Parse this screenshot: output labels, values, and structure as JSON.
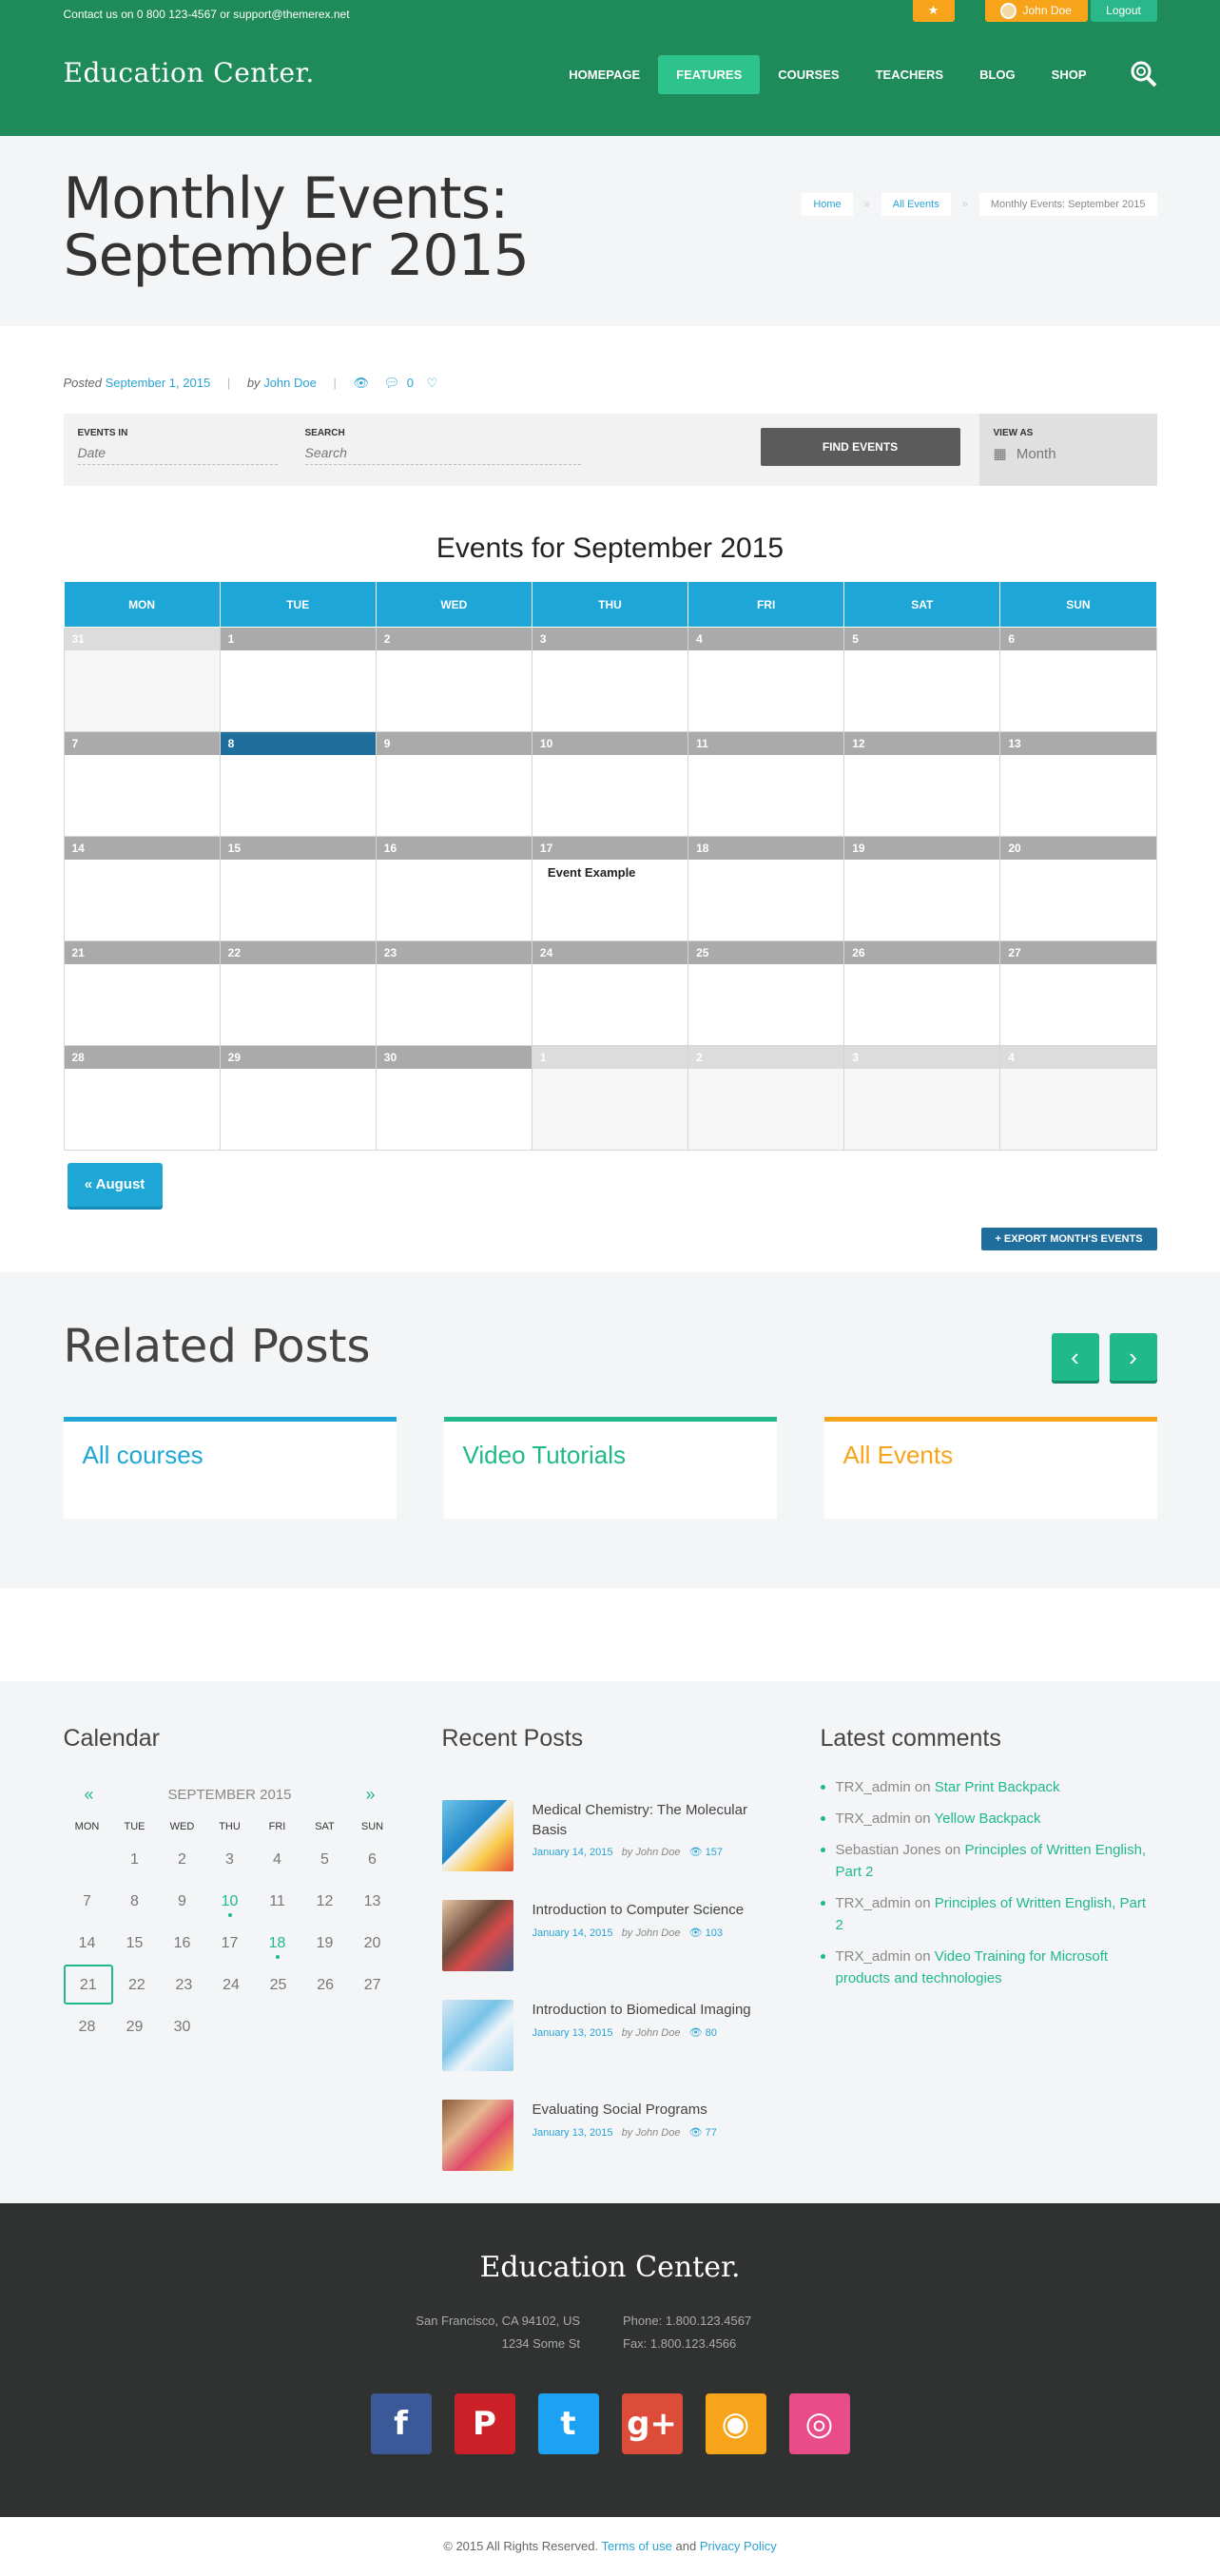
{
  "topbar": {
    "contact": "Contact us on 0 800 123-4567 or support@themerex.net",
    "user": "John Doe",
    "logout": "Logout",
    "star_icon": "star-icon"
  },
  "logo": "Education Center.",
  "nav": [
    "HOMEPAGE",
    "FEATURES",
    "COURSES",
    "TEACHERS",
    "BLOG",
    "SHOP"
  ],
  "page_title": "Monthly Events: September 2015",
  "breadcrumbs": [
    "Home",
    "All Events",
    "Monthly Events: September 2015"
  ],
  "meta": {
    "posted": "Posted",
    "date": "September 1, 2015",
    "by": "by",
    "author": "John Doe",
    "comments": "0"
  },
  "filter": {
    "events_in_label": "EVENTS IN",
    "events_in_placeholder": "Date",
    "search_label": "SEARCH",
    "search_placeholder": "Search",
    "find_button": "FIND EVENTS",
    "view_as_label": "VIEW AS",
    "view_as_value": "Month"
  },
  "calendar": {
    "title": "Events for September 2015",
    "weekdays": [
      "MON",
      "TUE",
      "WED",
      "THU",
      "FRI",
      "SAT",
      "SUN"
    ],
    "weeks": [
      [
        {
          "d": "31",
          "o": true
        },
        {
          "d": "1"
        },
        {
          "d": "2"
        },
        {
          "d": "3"
        },
        {
          "d": "4"
        },
        {
          "d": "5"
        },
        {
          "d": "6"
        }
      ],
      [
        {
          "d": "7"
        },
        {
          "d": "8",
          "today": true
        },
        {
          "d": "9"
        },
        {
          "d": "10"
        },
        {
          "d": "11"
        },
        {
          "d": "12"
        },
        {
          "d": "13"
        }
      ],
      [
        {
          "d": "14"
        },
        {
          "d": "15"
        },
        {
          "d": "16"
        },
        {
          "d": "17",
          "event": "Event Example"
        },
        {
          "d": "18"
        },
        {
          "d": "19"
        },
        {
          "d": "20"
        }
      ],
      [
        {
          "d": "21"
        },
        {
          "d": "22"
        },
        {
          "d": "23"
        },
        {
          "d": "24"
        },
        {
          "d": "25"
        },
        {
          "d": "26"
        },
        {
          "d": "27"
        }
      ],
      [
        {
          "d": "28"
        },
        {
          "d": "29"
        },
        {
          "d": "30"
        },
        {
          "d": "1",
          "o": true
        },
        {
          "d": "2",
          "o": true
        },
        {
          "d": "3",
          "o": true
        },
        {
          "d": "4",
          "o": true
        }
      ]
    ],
    "prev_button": "« August",
    "export_button": "+ EXPORT MONTH'S EVENTS"
  },
  "related": {
    "title": "Related Posts",
    "cards": [
      {
        "label": "All courses",
        "color": "#1ea7d6"
      },
      {
        "label": "Video Tutorials",
        "color": "#1fb98a"
      },
      {
        "label": "All Events",
        "color": "#f7a41b"
      }
    ]
  },
  "widgets": {
    "calendar_title": "Calendar",
    "mini_calendar": {
      "prev": "«",
      "next": "»",
      "month": "SEPTEMBER 2015",
      "weekdays": [
        "MON",
        "TUE",
        "WED",
        "THU",
        "FRI",
        "SAT",
        "SUN"
      ],
      "weeks": [
        [
          "",
          "1",
          "2",
          "3",
          "4",
          "5",
          "6"
        ],
        [
          "7",
          "8",
          "9",
          "10",
          "11",
          "12",
          "13"
        ],
        [
          "14",
          "15",
          "16",
          "17",
          "18",
          "19",
          "20"
        ],
        [
          "21",
          "22",
          "23",
          "24",
          "25",
          "26",
          "27"
        ],
        [
          "28",
          "29",
          "30",
          "",
          "",
          "",
          ""
        ]
      ],
      "event_days": [
        "10",
        "18"
      ],
      "today": "21"
    },
    "recent_title": "Recent Posts",
    "recent_posts": [
      {
        "title": "Medical Chemistry: The Molecular Basis",
        "date": "January 14, 2015",
        "by": "by",
        "author": "John Doe",
        "views": "157"
      },
      {
        "title": "Introduction to Computer Science",
        "date": "January 14, 2015",
        "by": "by",
        "author": "John Doe",
        "views": "103"
      },
      {
        "title": "Introduction to Biomedical Imaging",
        "date": "January 13, 2015",
        "by": "by",
        "author": "John Doe",
        "views": "80"
      },
      {
        "title": "Evaluating Social Programs",
        "date": "January 13, 2015",
        "by": "by",
        "author": "John Doe",
        "views": "77"
      }
    ],
    "comments_title": "Latest comments",
    "comments": [
      {
        "author": "TRX_admin",
        "on": "on",
        "post": "Star Print Backpack"
      },
      {
        "author": "TRX_admin",
        "on": "on",
        "post": "Yellow Backpack"
      },
      {
        "author": "Sebastian Jones",
        "on": "on",
        "post": "Principles of Written English, Part 2"
      },
      {
        "author": "TRX_admin",
        "on": "on",
        "post": "Principles of Written English, Part 2"
      },
      {
        "author": "TRX_admin",
        "on": "on",
        "post": "Video Training for Microsoft products and technologies"
      }
    ]
  },
  "footer": {
    "logo": "Education Center.",
    "address1": "San Francisco, CA 94102, US",
    "address2": "1234 Some St",
    "phone": "Phone: 1.800.123.4567",
    "fax": "Fax: 1.800.123.4566",
    "social": [
      {
        "icon": "facebook-icon",
        "glyph": "f",
        "color": "#3b5998"
      },
      {
        "icon": "pinterest-icon",
        "glyph": "P",
        "color": "#cb2027"
      },
      {
        "icon": "twitter-icon",
        "glyph": "t",
        "color": "#1da1f2"
      },
      {
        "icon": "google-plus-icon",
        "glyph": "g+",
        "color": "#dd4b39"
      },
      {
        "icon": "rss-icon",
        "glyph": "◉",
        "color": "#f7a41b"
      },
      {
        "icon": "dribbble-icon",
        "glyph": "◎",
        "color": "#ea4c89"
      }
    ],
    "copyright": "© 2015 All Rights Reserved.",
    "terms": "Terms of use",
    "and": "and",
    "privacy": "Privacy Policy"
  }
}
